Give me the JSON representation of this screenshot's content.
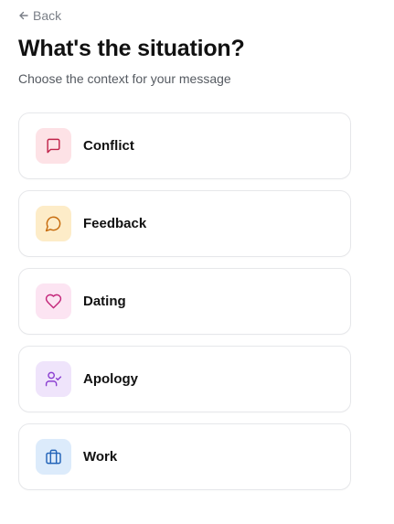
{
  "nav": {
    "back_label": "Back"
  },
  "header": {
    "title": "What's the situation?",
    "subtitle": "Choose the context for your message"
  },
  "options": [
    {
      "label": "Conflict",
      "icon": "message-square-icon",
      "bg": "#fde2e6",
      "fg": "#c0234a"
    },
    {
      "label": "Feedback",
      "icon": "message-circle-icon",
      "bg": "#fdecc8",
      "fg": "#c66a0b"
    },
    {
      "label": "Dating",
      "icon": "heart-icon",
      "bg": "#fce4f2",
      "fg": "#c4267a"
    },
    {
      "label": "Apology",
      "icon": "user-check-icon",
      "bg": "#efe4fb",
      "fg": "#8b3fd1"
    },
    {
      "label": "Work",
      "icon": "briefcase-icon",
      "bg": "#dcebfb",
      "fg": "#2263b8"
    }
  ]
}
